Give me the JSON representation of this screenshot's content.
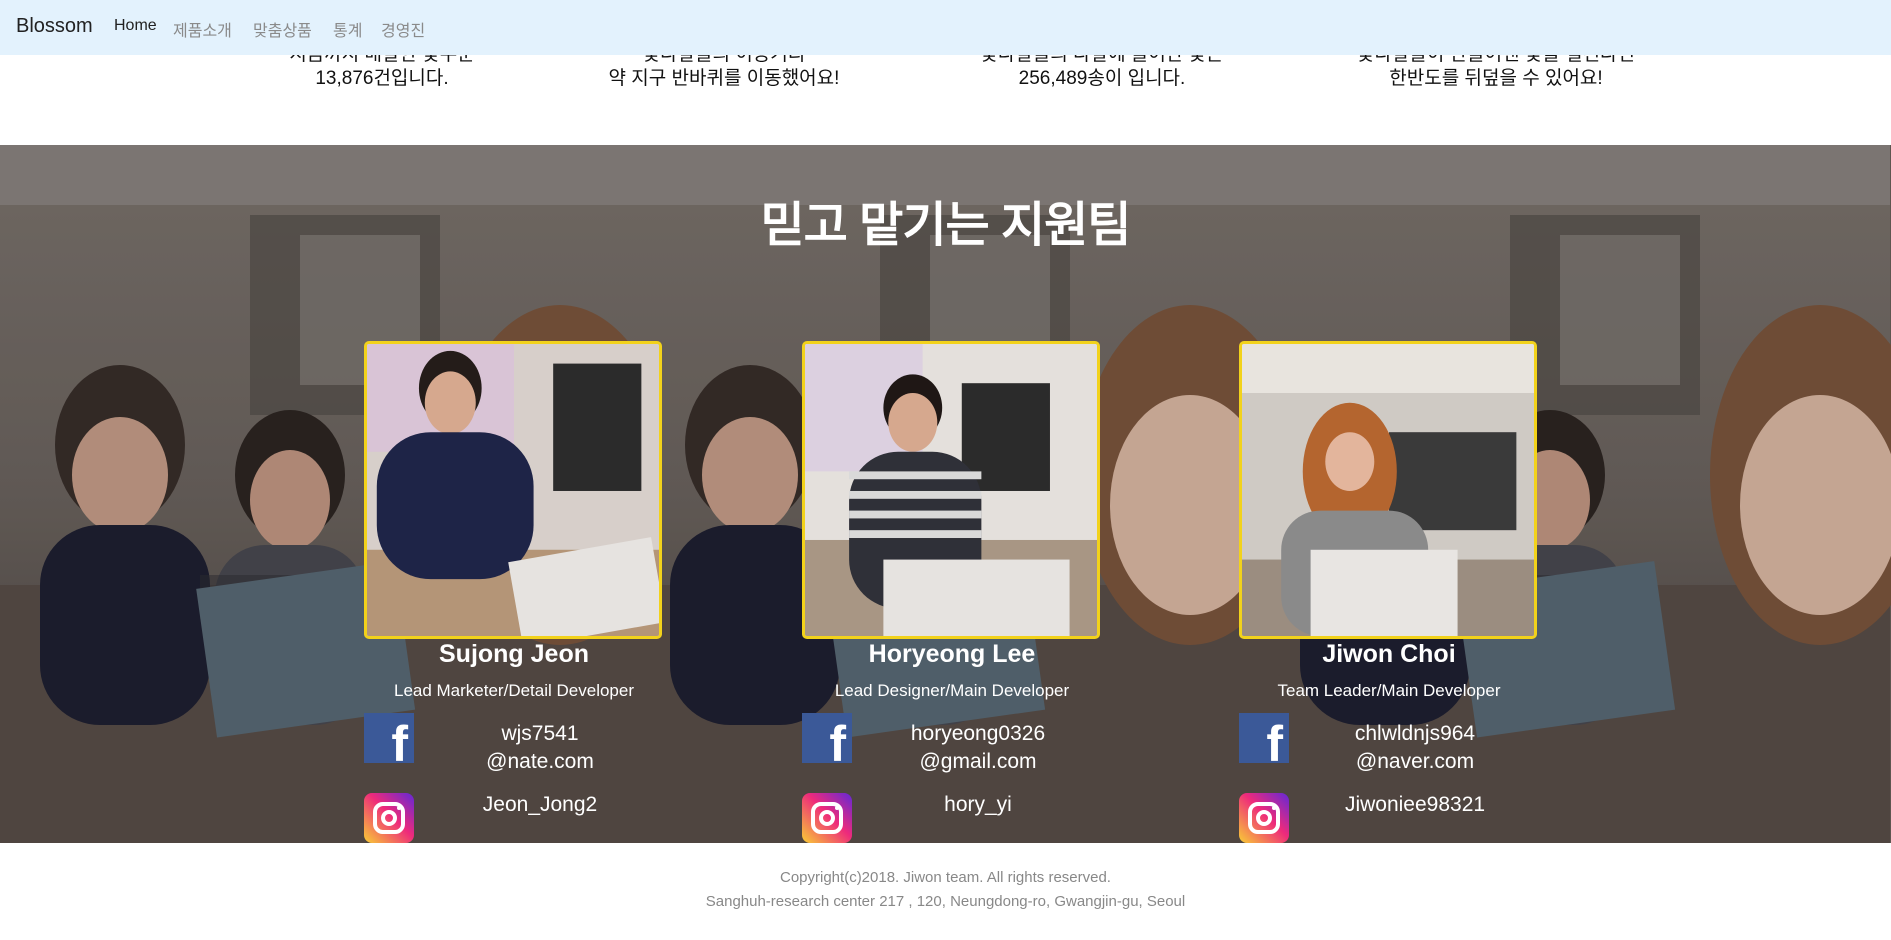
{
  "navbar": {
    "brand": "Blossom",
    "links": [
      "Home",
      "제품소개",
      "맞춤상품",
      "통계",
      "경영진"
    ]
  },
  "stats": [
    {
      "line1": "지금까지 배달한 꽃주문",
      "line2": "13,876건입니다."
    },
    {
      "line1": "꽃다발들의 이동거리",
      "line2": "약 지구 반바퀴를 이동했어요!"
    },
    {
      "line1": "꽃다발들의 다발에 들어간 꽃은",
      "line2": "256,489송이 입니다."
    },
    {
      "line1": "꽃다발들이 만들어낸 꽃을 펼친다면",
      "line2": "한반도를 뒤덮을 수 있어요!"
    }
  ],
  "team": {
    "title": "믿고 맡기는 지원팀",
    "members": [
      {
        "name": "Sujong Jeon",
        "role": "Lead Marketer/Detail Developer",
        "email_user": "wjs7541",
        "email_domain": "@nate.com",
        "instagram": "Jeon_Jong2"
      },
      {
        "name": "Horyeong Lee",
        "role": "Lead Designer/Main Developer",
        "email_user": "horyeong0326",
        "email_domain": "@gmail.com",
        "instagram": "hory_yi"
      },
      {
        "name": "Jiwon Choi",
        "role": "Team Leader/Main Developer",
        "email_user": "chlwldnjs964",
        "email_domain": "@naver.com",
        "instagram": "Jiwoniee98321"
      }
    ]
  },
  "icons": {
    "facebook": "facebook-icon",
    "instagram": "instagram-icon"
  },
  "colors": {
    "navbar_bg": "#e3f2fd",
    "photo_border": "#f2d21b",
    "facebook": "#3b5998"
  },
  "footer": {
    "line1": "Copyright(c)2018. Jiwon team. All rights reserved.",
    "line2": "Sanghuh-research center 217 , 120, Neungdong-ro, Gwangjin-gu, Seoul"
  }
}
